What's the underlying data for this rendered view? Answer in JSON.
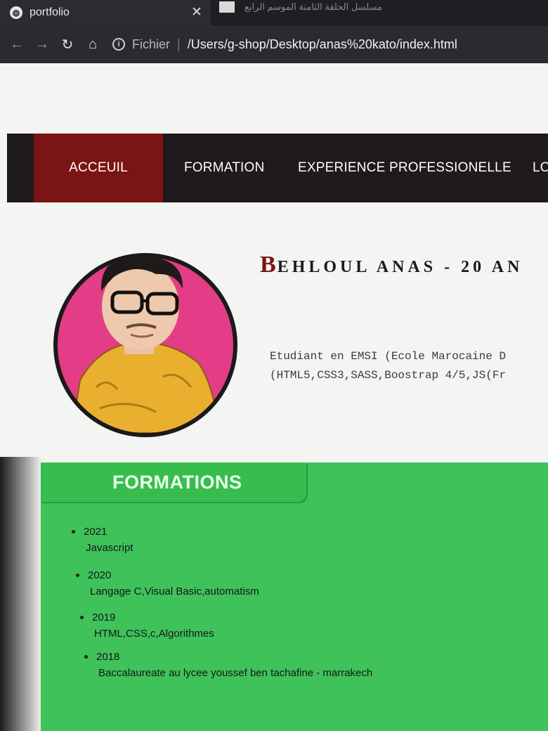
{
  "browser": {
    "active_tab_title": "portfolio",
    "other_tab_title": "مسلسل الحلقة الثامنة الموسم الرابع",
    "scheme_label": "Fichier",
    "url": "/Users/g-shop/Desktop/anas%20kato/index.html"
  },
  "nav": {
    "items": [
      "ACCEUIL",
      "FORMATION",
      "EXPERIENCE PROFESSIONELLE",
      "LO"
    ]
  },
  "profile": {
    "name_first_letter": "B",
    "name_rest": "EHLOUL ANAS - 20 AN",
    "description_line1": "Etudiant en EMSI (Ecole Marocaine D",
    "description_line2": "(HTML5,CSS3,SASS,Boostrap 4/5,JS(Fr"
  },
  "formations": {
    "heading": "FORMATIONS",
    "items": [
      {
        "year": "2021",
        "detail": "Javascript"
      },
      {
        "year": "2020",
        "detail": "Langage C,Visual Basic,automatism"
      },
      {
        "year": "2019",
        "detail": "HTML,CSS,c,Algorithmes"
      },
      {
        "year": "2018",
        "detail": "Baccalaureate au lycee youssef ben tachafine - marrakech"
      }
    ]
  },
  "colors": {
    "nav_bg": "#1f1a1b",
    "nav_active": "#7a1415",
    "formation_green": "#3fc25a",
    "avatar_bg": "#e23d86"
  }
}
